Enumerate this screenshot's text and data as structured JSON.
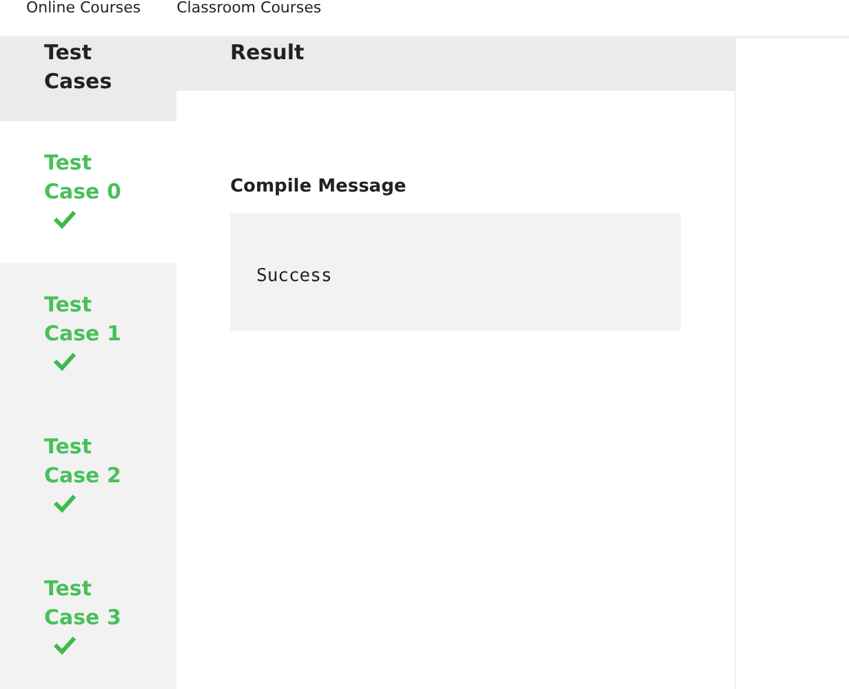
{
  "nav": {
    "links": [
      "Online Courses",
      "Classroom Courses"
    ]
  },
  "sidebar": {
    "heading": "Test Cases",
    "items": [
      {
        "label": "Test Case 0",
        "selected": true,
        "passed": true
      },
      {
        "label": "Test Case 1",
        "selected": false,
        "passed": true
      },
      {
        "label": "Test Case 2",
        "selected": false,
        "passed": true
      },
      {
        "label": "Test Case 3",
        "selected": false,
        "passed": true
      }
    ]
  },
  "result": {
    "heading": "Result",
    "section_title": "Compile Message",
    "message": "Success"
  }
}
